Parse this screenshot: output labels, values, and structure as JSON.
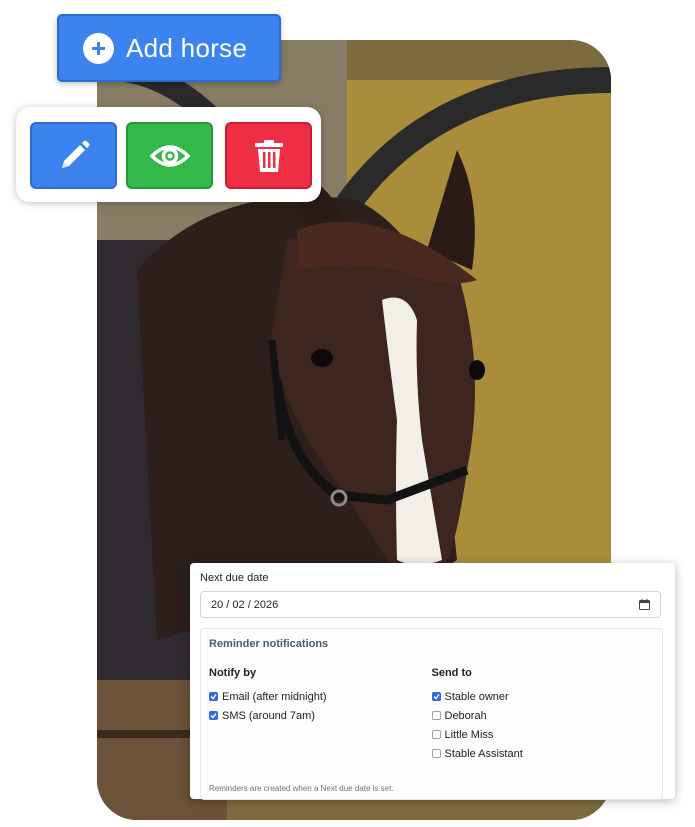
{
  "add_button": {
    "label": "Add horse",
    "icon": "plus-circle-icon"
  },
  "actions": [
    {
      "name": "edit",
      "icon": "pencil-icon",
      "color": "#3d83f0"
    },
    {
      "name": "view",
      "icon": "eye-icon",
      "color": "#33b84a"
    },
    {
      "name": "delete",
      "icon": "trash-icon",
      "color": "#ee2e42"
    }
  ],
  "form": {
    "due_label": "Next due date",
    "due_value": "20 / 02 / 2026",
    "calendar_icon": "calendar-icon",
    "reminder_title": "Reminder notifications",
    "notify_by": {
      "title": "Notify by",
      "options": [
        {
          "label": "Email (after midnight)",
          "checked": true
        },
        {
          "label": "SMS (around 7am)",
          "checked": true
        }
      ]
    },
    "send_to": {
      "title": "Send to",
      "options": [
        {
          "label": "Stable owner",
          "checked": true
        },
        {
          "label": "Deborah",
          "checked": false
        },
        {
          "label": "Little Miss",
          "checked": false
        },
        {
          "label": "Stable Assistant",
          "checked": false
        }
      ]
    },
    "footnote": "Reminders are created when a Next due date is set."
  }
}
